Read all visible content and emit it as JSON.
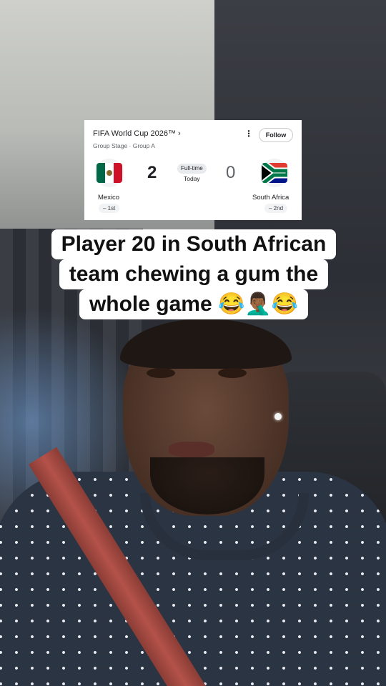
{
  "scorecard": {
    "title": "FIFA World Cup 2026™ ›",
    "subtitle": "Group Stage · Group A",
    "menu_icon": "more-vertical-icon",
    "follow_label": "Follow",
    "status": "Full-time",
    "date": "Today",
    "home": {
      "name": "Mexico",
      "score": "2",
      "rank": "– 1st",
      "flag_colors": [
        "#006847",
        "#ffffff",
        "#ce1126"
      ]
    },
    "away": {
      "name": "South Africa",
      "score": "0",
      "rank": "– 2nd",
      "flag_colors": [
        "#e03c31",
        "#001489",
        "#007749",
        "#ffb81c",
        "#000000",
        "#ffffff"
      ]
    }
  },
  "caption": {
    "line1": "Player 20 in South African",
    "line2": "team chewing a gum the",
    "line3": "whole game 😂🤦🏾‍♂️😂"
  }
}
